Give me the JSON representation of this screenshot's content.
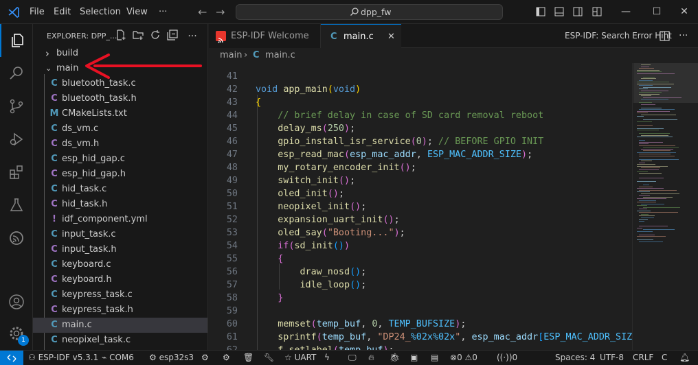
{
  "titlebar": {
    "menus": [
      "File",
      "Edit",
      "Selection",
      "View",
      "···"
    ],
    "search_text": "dpp_fw",
    "icons": [
      "vscode-logo-icon",
      "back-arrow-icon",
      "forward-arrow-icon",
      "search-icon",
      "toggle-sidebar-icon",
      "toggle-panel-icon",
      "toggle-secondary-sidebar-icon",
      "customize-layout-icon",
      "minimize-icon",
      "maximize-icon",
      "close-icon"
    ]
  },
  "activity": {
    "items": [
      "explorer-icon",
      "search-icon",
      "source-control-icon",
      "run-debug-icon",
      "extensions-icon",
      "testing-icon",
      "esp-idf-icon"
    ],
    "bottom": [
      "accounts-icon",
      "manage-gear-icon"
    ],
    "badge": "1"
  },
  "sidebar": {
    "title": "EXPLORER: DPP_...",
    "tree": [
      {
        "name": "build",
        "type": "folder",
        "open": false
      },
      {
        "name": "main",
        "type": "folder",
        "open": true
      },
      {
        "name": "bluetooth_task.c",
        "icon": "C",
        "color": "#519aba"
      },
      {
        "name": "bluetooth_task.h",
        "icon": "C",
        "color": "#a074c4"
      },
      {
        "name": "CMakeLists.txt",
        "icon": "M",
        "color": "#519aba"
      },
      {
        "name": "ds_vm.c",
        "icon": "C",
        "color": "#519aba"
      },
      {
        "name": "ds_vm.h",
        "icon": "C",
        "color": "#a074c4"
      },
      {
        "name": "esp_hid_gap.c",
        "icon": "C",
        "color": "#519aba"
      },
      {
        "name": "esp_hid_gap.h",
        "icon": "C",
        "color": "#a074c4"
      },
      {
        "name": "hid_task.c",
        "icon": "C",
        "color": "#519aba"
      },
      {
        "name": "hid_task.h",
        "icon": "C",
        "color": "#a074c4"
      },
      {
        "name": "idf_component.yml",
        "icon": "!",
        "color": "#a074c4"
      },
      {
        "name": "input_task.c",
        "icon": "C",
        "color": "#519aba"
      },
      {
        "name": "input_task.h",
        "icon": "C",
        "color": "#a074c4"
      },
      {
        "name": "keyboard.c",
        "icon": "C",
        "color": "#519aba"
      },
      {
        "name": "keyboard.h",
        "icon": "C",
        "color": "#a074c4"
      },
      {
        "name": "keypress_task.c",
        "icon": "C",
        "color": "#519aba"
      },
      {
        "name": "keypress_task.h",
        "icon": "C",
        "color": "#a074c4"
      },
      {
        "name": "main.c",
        "icon": "C",
        "color": "#519aba",
        "selected": true
      },
      {
        "name": "neopixel_task.c",
        "icon": "C",
        "color": "#519aba"
      }
    ]
  },
  "tabs": [
    {
      "label": "ESP-IDF Welcome",
      "active": false
    },
    {
      "label": "main.c",
      "active": true
    }
  ],
  "editor_actions": {
    "hint": "ESP-IDF: Search Error Hint"
  },
  "breadcrumb": {
    "folder": "main",
    "file": "main.c"
  },
  "code": {
    "line_numbers": [
      "41",
      "42",
      "43",
      "44",
      "45",
      "46",
      "47",
      "48",
      "49",
      "50",
      "51",
      "52",
      "53",
      "54",
      "55",
      "56",
      "57",
      "58",
      "59",
      "60",
      "61",
      "62"
    ]
  },
  "statusbar": {
    "idf": "ESP-IDF v5.3.1",
    "port": "COM6",
    "target": "esp32s3",
    "uart": "UART",
    "errors": "0",
    "warnings": "0",
    "infos": "0",
    "spaces": "Spaces: 4",
    "encoding": "UTF-8",
    "eol": "CRLF",
    "language": "C"
  },
  "colors": {
    "accent": "#0078d4",
    "arrow": "#e81123"
  }
}
